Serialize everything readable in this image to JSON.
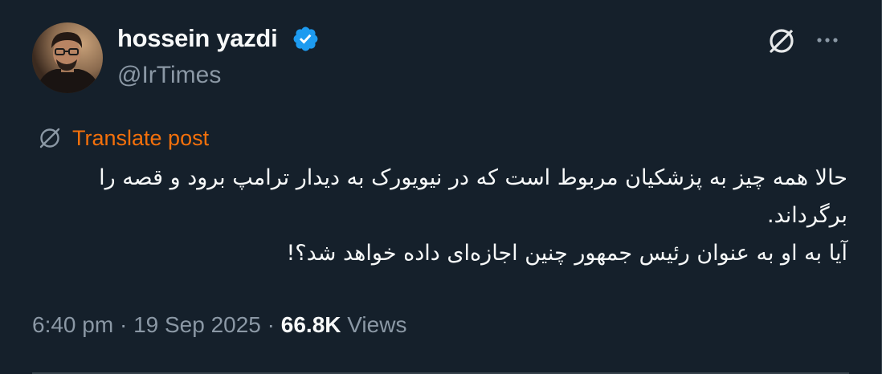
{
  "author": {
    "display_name": "hossein yazdi",
    "handle": "@IrTimes",
    "verified": true,
    "avatar_icon": "profile-photo"
  },
  "actions": {
    "grok_icon": "grok-slash-icon",
    "more_icon": "more-horizontal-icon"
  },
  "translate": {
    "label": "Translate post",
    "icon": "grok-slash-icon",
    "color": "#f4700b"
  },
  "body": {
    "paragraph_1": "حالا همه چیز به پزشکیان مربوط است که در نیویورک به دیدار ترامپ برود و قصه را برگرداند.",
    "paragraph_2": "آیا به او به عنوان رئیس جمهور چنین اجازه‌ای داده خواهد شد؟!"
  },
  "meta": {
    "time": "6:40 pm",
    "separator": " · ",
    "date": "19 Sep 2025",
    "views_count": "66.8K",
    "views_label": "Views"
  },
  "colors": {
    "background": "#15202b",
    "primary_text": "#f7f9f9",
    "secondary_text": "#8b98a5",
    "verified_badge": "#1d9bf0",
    "divider": "#38444d"
  }
}
